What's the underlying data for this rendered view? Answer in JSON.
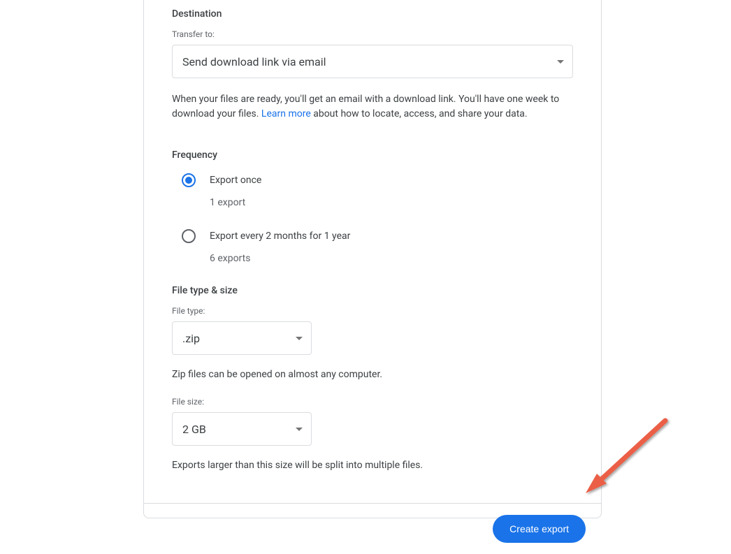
{
  "destination": {
    "header": "Destination",
    "field_label": "Transfer to:",
    "selected": "Send download link via email",
    "help_text_before": "When your files are ready, you'll get an email with a download link. You'll have one week to download your files. ",
    "learn_more": "Learn more",
    "help_text_after": " about how to locate, access, and share your data."
  },
  "frequency": {
    "header": "Frequency",
    "options": [
      {
        "label": "Export once",
        "sub": "1 export",
        "selected": true
      },
      {
        "label": "Export every 2 months for 1 year",
        "sub": "6 exports",
        "selected": false
      }
    ]
  },
  "filetype": {
    "header": "File type & size",
    "type_label": "File type:",
    "type_value": ".zip",
    "type_help": "Zip files can be opened on almost any computer.",
    "size_label": "File size:",
    "size_value": "2 GB",
    "size_help": "Exports larger than this size will be split into multiple files."
  },
  "footer": {
    "create_label": "Create export"
  }
}
